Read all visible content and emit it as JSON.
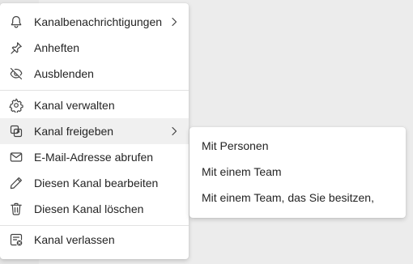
{
  "menu": {
    "items": [
      {
        "label": "Kanalbenachrichtigungen",
        "icon": "bell-icon",
        "has_submenu": true
      },
      {
        "label": "Anheften",
        "icon": "pin-icon"
      },
      {
        "label": "Ausblenden",
        "icon": "eye-off-icon"
      },
      {
        "label": "Kanal verwalten",
        "icon": "gear-icon"
      },
      {
        "label": "Kanal freigeben",
        "icon": "share-channel-icon",
        "has_submenu": true,
        "highlighted": true
      },
      {
        "label": "E-Mail-Adresse abrufen",
        "icon": "mail-icon"
      },
      {
        "label": "Diesen Kanal bearbeiten",
        "icon": "pencil-icon"
      },
      {
        "label": "Diesen Kanal löschen",
        "icon": "trash-icon"
      },
      {
        "label": "Kanal verlassen",
        "icon": "leave-channel-icon"
      }
    ]
  },
  "submenu": {
    "items": [
      {
        "label": "Mit Personen"
      },
      {
        "label": "Mit einem Team"
      },
      {
        "label": "Mit einem Team, das Sie besitzen,"
      }
    ]
  },
  "colors": {
    "text": "#242424",
    "icon": "#424242",
    "hover": "#f0f0f0",
    "divider": "#e1e1e1",
    "backdrop": "#ebebeb"
  }
}
